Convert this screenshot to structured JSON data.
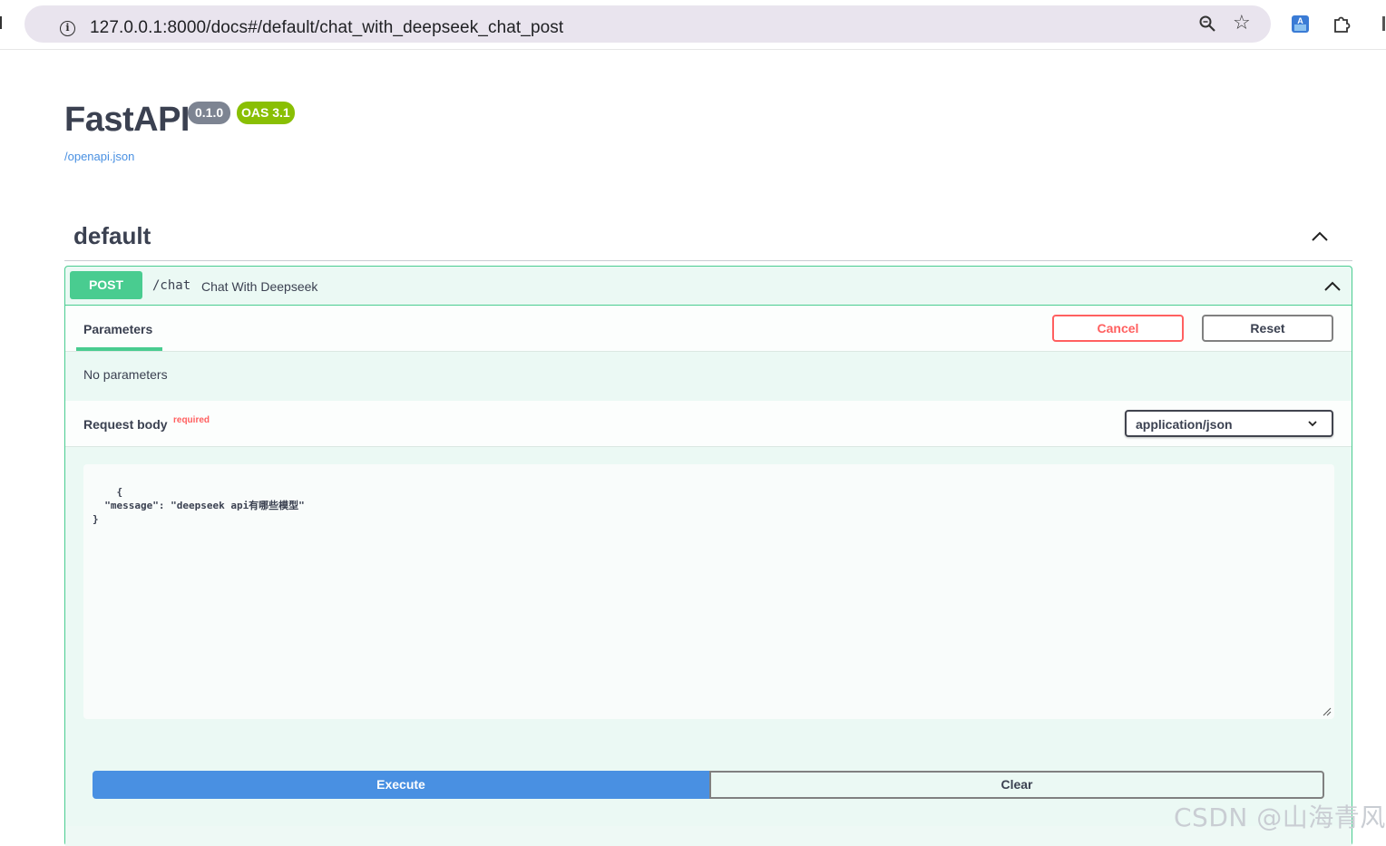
{
  "browser": {
    "url": "127.0.0.1:8000/docs#/default/chat_with_deepseek_chat_post",
    "icons": [
      "info-icon",
      "zoom-icon",
      "star-icon",
      "translate-extension-icon",
      "extensions-icon"
    ]
  },
  "api": {
    "title": "FastAPI",
    "version": "0.1.0",
    "oas": "OAS 3.1",
    "spec_link": "/openapi.json"
  },
  "tag": {
    "name": "default"
  },
  "operation": {
    "method": "POST",
    "path": "/chat",
    "summary": "Chat With Deepseek",
    "parameters_tab": "Parameters",
    "cancel_label": "Cancel",
    "reset_label": "Reset",
    "no_params": "No parameters",
    "request_body_label": "Request body",
    "required_label": "required",
    "content_type": "application/json",
    "request_body": "{\n  \"message\": \"deepseek api有哪些模型\"\n}",
    "execute_label": "Execute",
    "clear_label": "Clear"
  },
  "watermark": "CSDN @山海青风",
  "colors": {
    "post": "#49cc90",
    "cancel": "#ff6060",
    "execute": "#4990e2",
    "oas_badge": "#89bf04",
    "version_badge": "#7d8492"
  }
}
